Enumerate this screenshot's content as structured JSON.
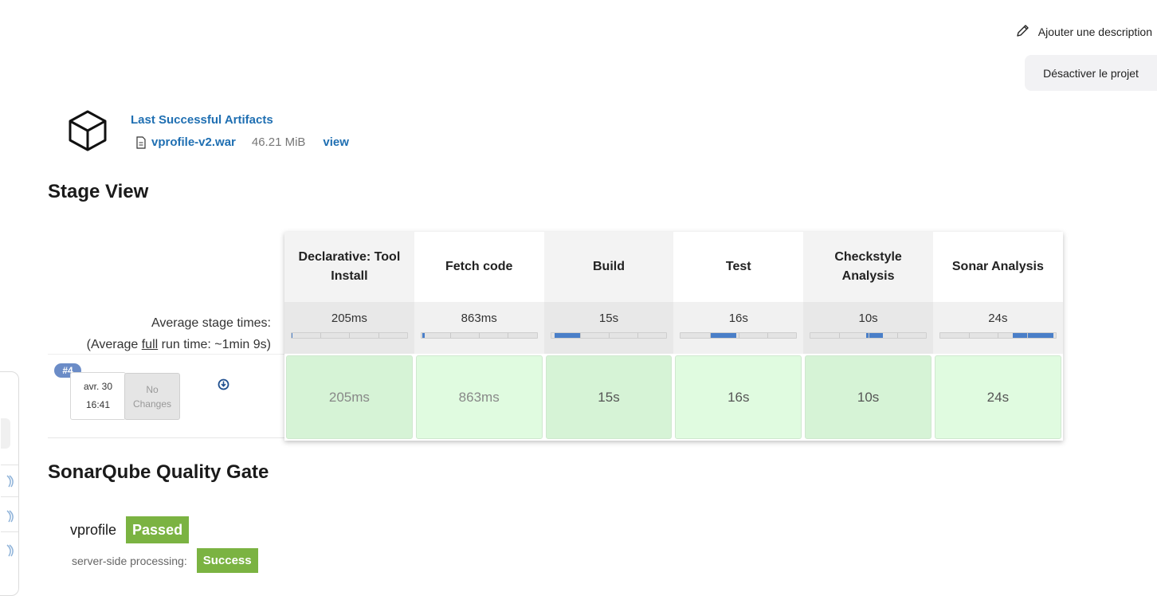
{
  "header": {
    "add_description": "Ajouter une description",
    "disable_project": "Désactiver le projet"
  },
  "artifacts": {
    "title": "Last Successful Artifacts",
    "file_name": "vprofile-v2.war",
    "file_size": "46.21 MiB",
    "view_label": "view"
  },
  "stage_view": {
    "title": "Stage View",
    "avg_label_line1": "Average stage times:",
    "avg_label_line2_prefix": "(Average ",
    "avg_label_line2_full": "full",
    "avg_label_line2_suffix": " run time: ~1min 9s)",
    "stages": [
      {
        "name": "Declarative: Tool Install",
        "avg": "205ms",
        "avg_fraction": 0.01,
        "run": "205ms"
      },
      {
        "name": "Fetch code",
        "avg": "863ms",
        "avg_fraction": 0.02,
        "run": "863ms"
      },
      {
        "name": "Build",
        "avg": "15s",
        "avg_fraction": 0.22,
        "run": "15s"
      },
      {
        "name": "Test",
        "avg": "16s",
        "avg_fraction": 0.23,
        "run": "16s"
      },
      {
        "name": "Checkstyle Analysis",
        "avg": "10s",
        "avg_fraction": 0.15,
        "run": "10s"
      },
      {
        "name": "Sonar Analysis",
        "avg": "24s",
        "avg_fraction": 0.35,
        "run": "24s"
      }
    ],
    "build": {
      "number": "#4",
      "date": "avr. 30",
      "time": "16:41",
      "changes_line1": "No",
      "changes_line2": "Changes"
    }
  },
  "sonarqube": {
    "title": "SonarQube Quality Gate",
    "project": "vprofile",
    "status": "Passed",
    "processing_label": "server-side processing:",
    "processing_status": "Success",
    "status_color": "#7bb342"
  }
}
